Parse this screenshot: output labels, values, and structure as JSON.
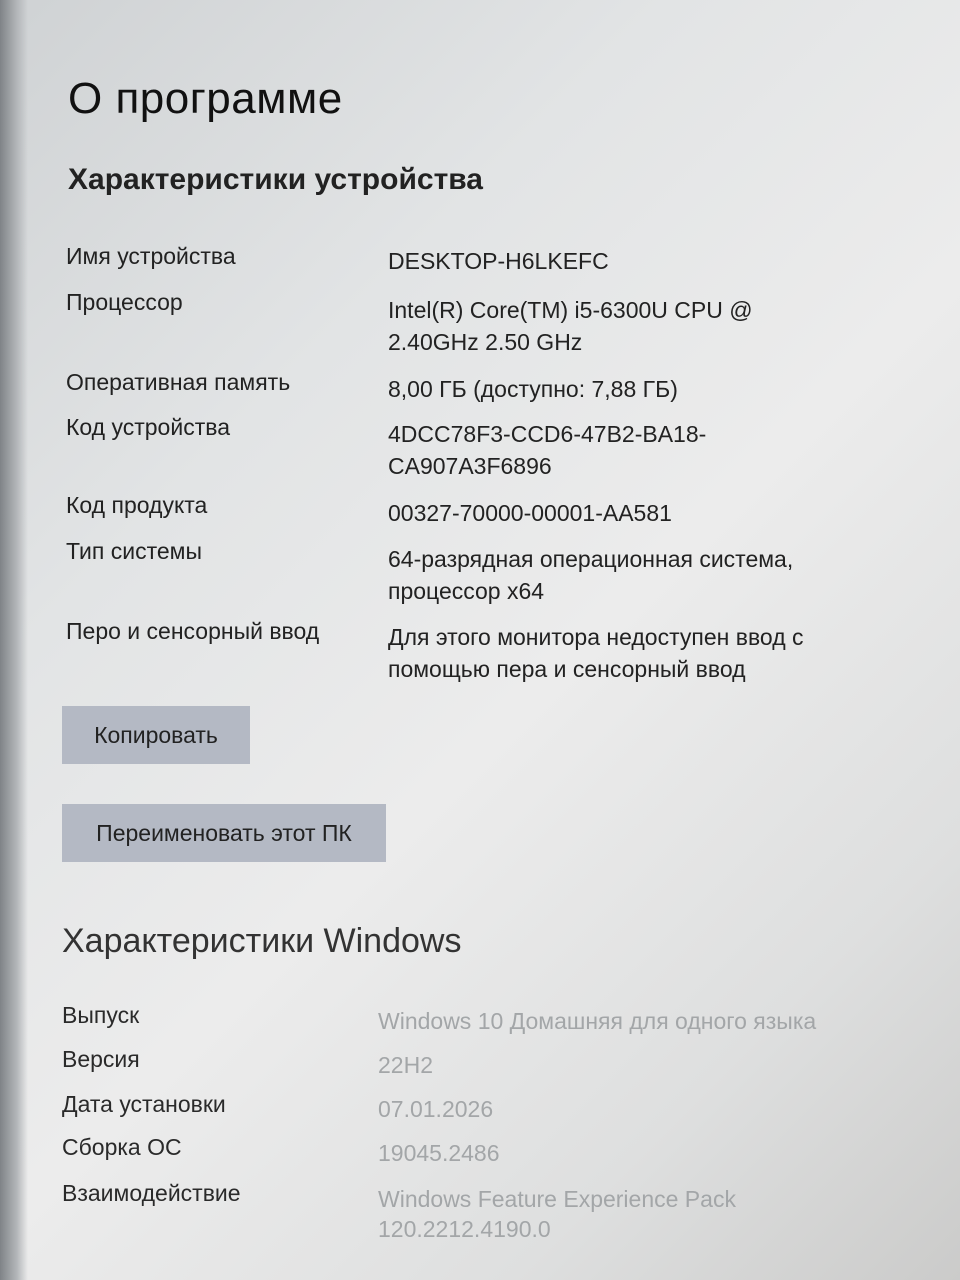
{
  "page": {
    "title": "О программе"
  },
  "device_specs": {
    "title": "Характеристики устройства",
    "rows": [
      {
        "label": "Имя устройства",
        "value": "DESKTOP-H6LKEFC"
      },
      {
        "label": "Процессор",
        "value": "Intel(R) Core(TM) i5-6300U CPU @ 2.40GHz   2.50 GHz"
      },
      {
        "label": "Оперативная память",
        "value": "8,00 ГБ (доступно: 7,88 ГБ)"
      },
      {
        "label": "Код устройства",
        "value": "4DCC78F3-CCD6-47B2-BA18-CA907A3F6896"
      },
      {
        "label": "Код продукта",
        "value": "00327-70000-00001-AA581"
      },
      {
        "label": "Тип системы",
        "value": "64-разрядная операционная система, процессор x64"
      },
      {
        "label": "Перо и сенсорный ввод",
        "value": "Для этого монитора недоступен ввод с помощью пера и сенсорный ввод"
      }
    ]
  },
  "buttons": {
    "copy": "Копировать",
    "rename": "Переименовать этот ПК"
  },
  "windows_specs": {
    "title": "Характеристики Windows",
    "rows": [
      {
        "label": "Выпуск",
        "value": "Windows 10 Домашняя для одного языка"
      },
      {
        "label": "Версия",
        "value": "22H2"
      },
      {
        "label": "Дата установки",
        "value": "07.01.2026"
      },
      {
        "label": "Сборка ОС",
        "value": "19045.2486"
      },
      {
        "label": "Взаимодействие",
        "value": "Windows Feature Experience Pack 120.2212.4190.0"
      }
    ]
  }
}
